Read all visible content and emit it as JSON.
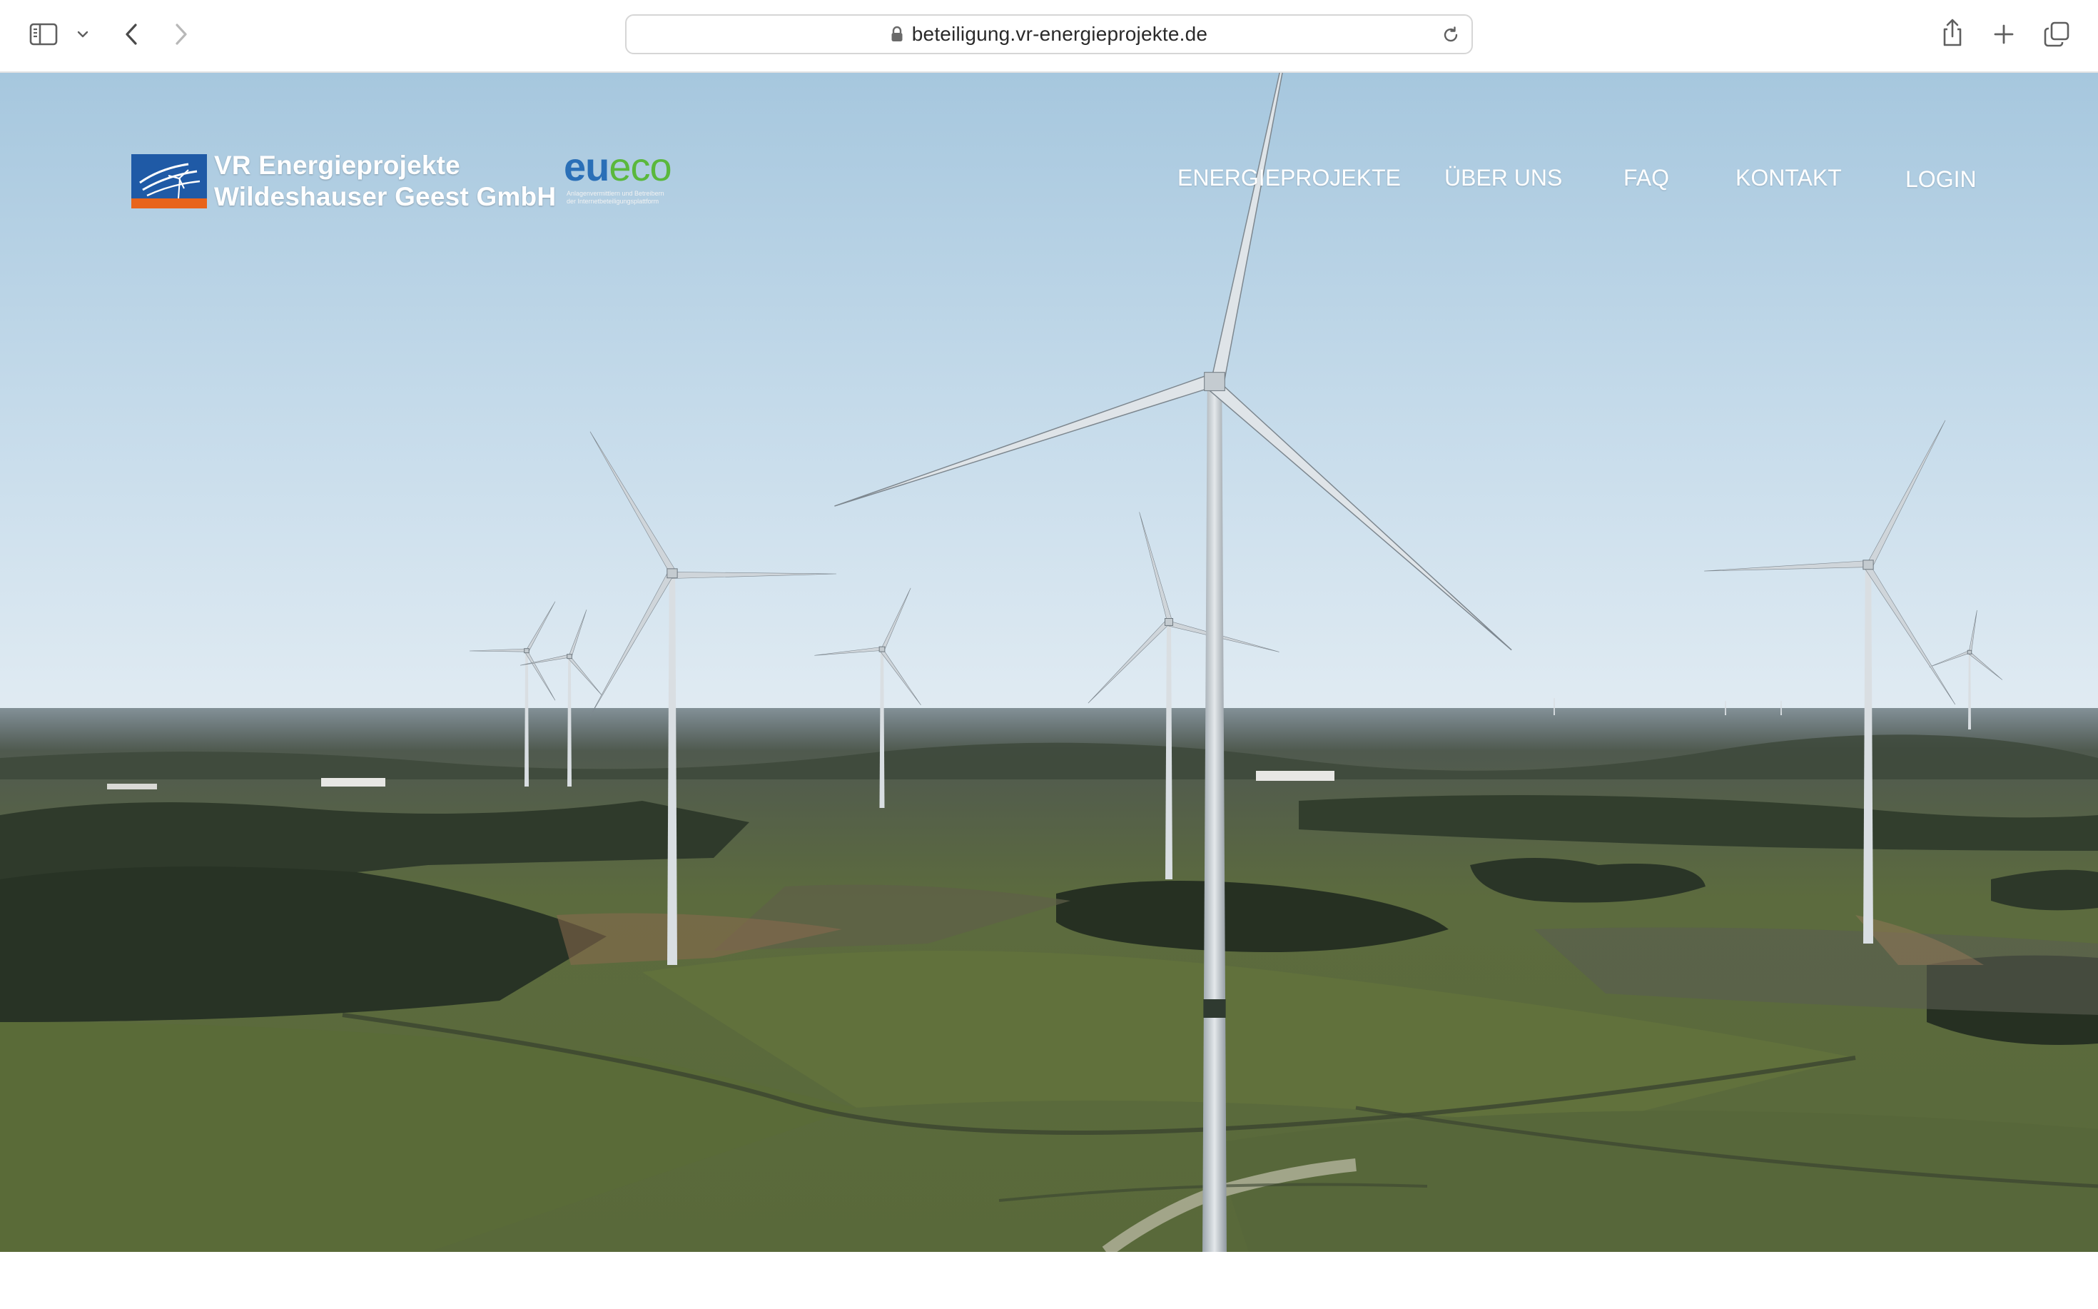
{
  "browser": {
    "url": "beteiligung.vr-energieprojekte.de",
    "icons": {
      "sidebar": "sidebar-icon",
      "sidebar_menu": "chevron-down-icon",
      "back": "chevron-left-icon",
      "forward": "chevron-right-icon",
      "lock": "lock-icon",
      "reload": "reload-icon",
      "share": "share-icon",
      "new_tab": "plus-icon",
      "tabs": "tabs-overview-icon"
    }
  },
  "site": {
    "brand": {
      "line1": "VR Energieprojekte",
      "line2": "Wildeshauser Geest GmbH"
    },
    "partner": {
      "eu": "eu",
      "eco": "eco",
      "tagline_1": "Anlagenvermittlern und Betreibern",
      "tagline_2": "der Internetbeteiligungsplattform"
    },
    "nav": [
      {
        "label": "ENERGIEPROJEKTE"
      },
      {
        "label": "ÜBER UNS"
      },
      {
        "label": "FAQ"
      },
      {
        "label": "KONTAKT"
      },
      {
        "label": "LOGIN"
      }
    ],
    "colors": {
      "brand_blue": "#1f5aa6",
      "brand_orange": "#e8641b",
      "eueco_blue": "#2a6fb7",
      "eueco_green": "#5ab83c"
    }
  }
}
